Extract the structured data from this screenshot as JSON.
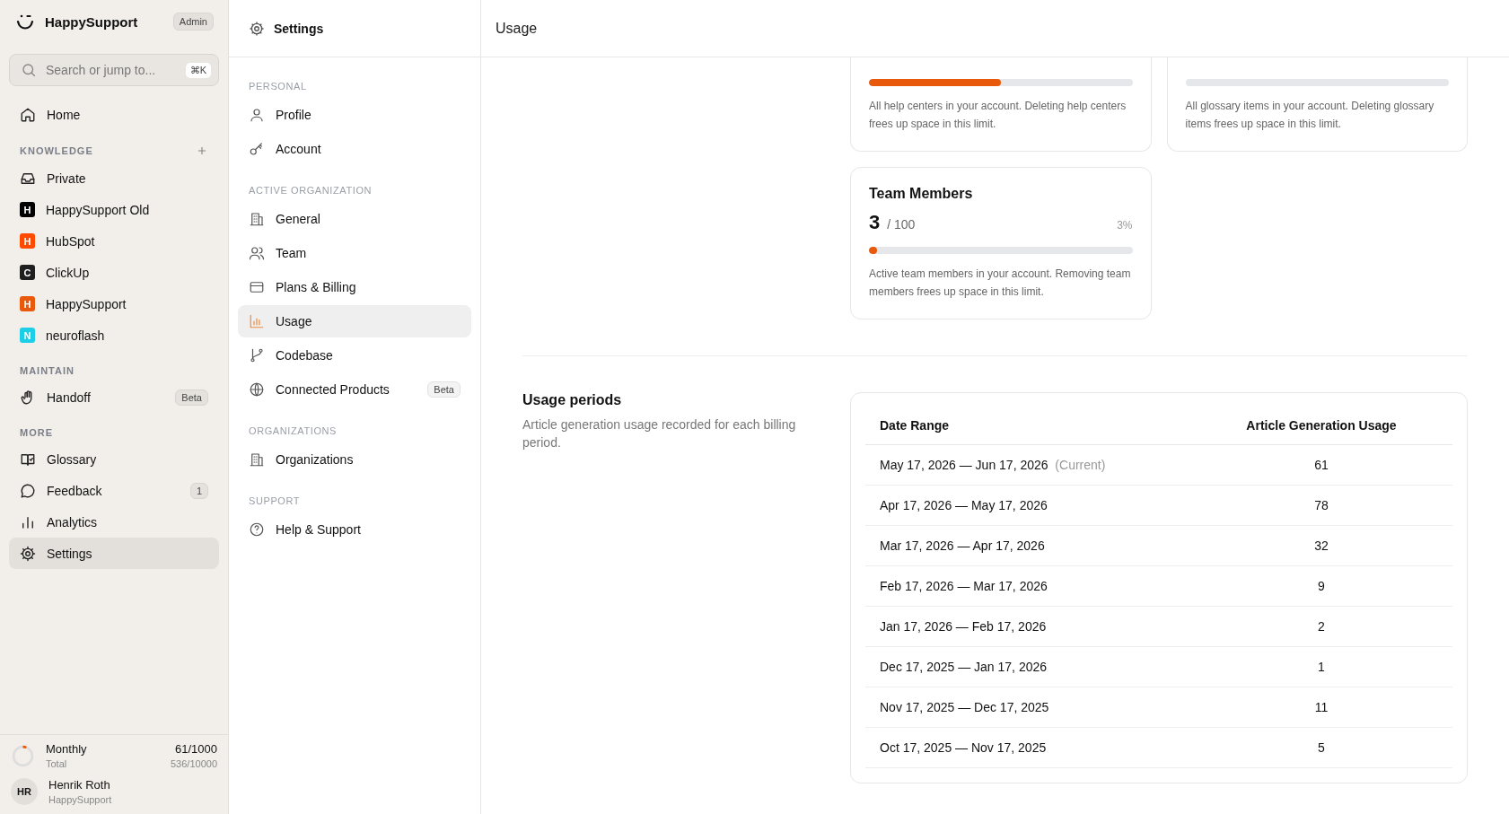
{
  "sidebar": {
    "brand": "HappySupport",
    "role_badge": "Admin",
    "search": {
      "placeholder": "Search or jump to...",
      "shortcut": "⌘K"
    },
    "home": {
      "label": "Home",
      "selected": false
    },
    "sections": [
      {
        "heading": "KNOWLEDGE",
        "addable": true,
        "items": [
          {
            "label": "Private",
            "kind": "icon",
            "selected": false
          },
          {
            "label": "HappySupport Old",
            "kind": "avatar",
            "letter": "H",
            "color": "#000000",
            "selected": false
          },
          {
            "label": "HubSpot",
            "kind": "avatar",
            "letter": "H",
            "color": "#ff4a00",
            "selected": false
          },
          {
            "label": "ClickUp",
            "kind": "avatar",
            "letter": "C",
            "color": "#1f1f1f",
            "selected": false
          },
          {
            "label": "HappySupport",
            "kind": "avatar",
            "letter": "H",
            "color": "#e8590c",
            "selected": false
          },
          {
            "label": "neuroflash",
            "kind": "avatar",
            "letter": "N",
            "color": "#1ccfe6",
            "selected": false
          }
        ]
      },
      {
        "heading": "MAINTAIN",
        "addable": false,
        "items": [
          {
            "label": "Handoff",
            "kind": "icon",
            "badge": "Beta",
            "selected": false
          }
        ]
      },
      {
        "heading": "MORE",
        "addable": false,
        "items": [
          {
            "label": "Glossary",
            "kind": "icon",
            "selected": false
          },
          {
            "label": "Feedback",
            "kind": "icon",
            "badge": "1",
            "selected": false
          },
          {
            "label": "Analytics",
            "kind": "icon",
            "selected": false
          },
          {
            "label": "Settings",
            "kind": "icon",
            "selected": true
          }
        ]
      }
    ],
    "usage": {
      "title": "Monthly",
      "value": "61/1000",
      "subtitle": "Total",
      "total": "536/10000",
      "level": 0.061
    },
    "user": {
      "initials": "HR",
      "name": "Henrik Roth",
      "org": "HappySupport"
    }
  },
  "settings_nav": {
    "title": "Settings",
    "groups": [
      {
        "heading": "PERSONAL",
        "items": [
          {
            "label": "Profile",
            "selected": false
          },
          {
            "label": "Account",
            "selected": false
          }
        ]
      },
      {
        "heading": "ACTIVE ORGANIZATION",
        "items": [
          {
            "label": "General",
            "selected": false
          },
          {
            "label": "Team",
            "selected": false
          },
          {
            "label": "Plans & Billing",
            "selected": false
          },
          {
            "label": "Usage",
            "selected": true
          },
          {
            "label": "Codebase",
            "selected": false
          },
          {
            "label": "Connected Products",
            "badge": "Beta",
            "selected": false
          }
        ]
      },
      {
        "heading": "ORGANIZATIONS",
        "items": [
          {
            "label": "Organizations",
            "selected": false
          }
        ]
      },
      {
        "heading": "SUPPORT",
        "items": [
          {
            "label": "Help & Support",
            "selected": false
          }
        ]
      }
    ]
  },
  "header": {
    "title": "Usage"
  },
  "limit_cards": [
    {
      "level": 0.5,
      "description": "All help centers in your account. Deleting help centers frees up space in this limit."
    },
    {
      "level": 0,
      "description": "All glossary items in your account. Deleting glossary items frees up space in this limit."
    },
    {
      "title": "Team Members",
      "count": "3",
      "limit": "/ 100",
      "percent": "3%",
      "level": 0.03,
      "description": "Active team members in your account. Removing team members frees up space in this limit."
    }
  ],
  "usage_periods": {
    "title": "Usage periods",
    "description": "Article generation usage recorded for each billing period.",
    "table": {
      "columns": [
        "Date Range",
        "Article Generation Usage"
      ],
      "rows": [
        {
          "date_range": "May 17, 2026 — Jun 17, 2026",
          "note": "(Current)",
          "usage": "61"
        },
        {
          "date_range": "Apr 17, 2026 — May 17, 2026",
          "usage": "78"
        },
        {
          "date_range": "Mar 17, 2026 — Apr 17, 2026",
          "usage": "32"
        },
        {
          "date_range": "Feb 17, 2026 — Mar 17, 2026",
          "usage": "9"
        },
        {
          "date_range": "Jan 17, 2026 — Feb 17, 2026",
          "usage": "2"
        },
        {
          "date_range": "Dec 17, 2025 — Jan 17, 2026",
          "usage": "1"
        },
        {
          "date_range": "Nov 17, 2025 — Dec 17, 2025",
          "usage": "11"
        },
        {
          "date_range": "Oct 17, 2025 — Nov 17, 2025",
          "usage": "5"
        }
      ]
    }
  }
}
